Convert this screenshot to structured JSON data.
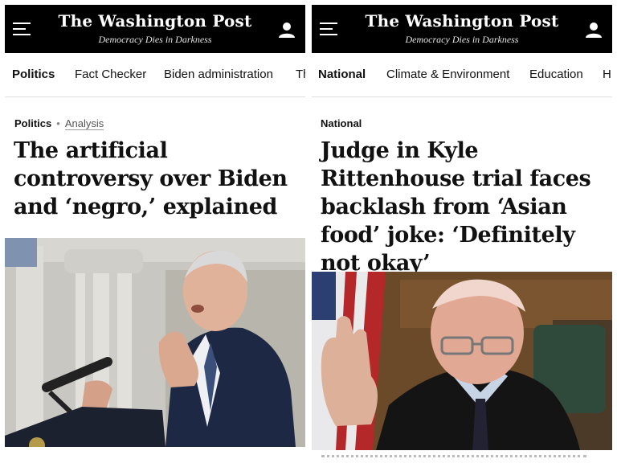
{
  "panels": [
    {
      "masthead": {
        "logo": "The Washington Post",
        "tagline": "Democracy Dies in Darkness"
      },
      "nav": [
        "Politics",
        "Fact Checker",
        "Biden administration",
        "Th"
      ],
      "active_nav": "Politics",
      "kicker": "Politics",
      "label": "Analysis",
      "headline": "The artificial controversy over Biden and ‘negro,’ explained",
      "image": "photo-biden-speaking-at-podium"
    },
    {
      "masthead": {
        "logo": "The Washington Post",
        "tagline": "Democracy Dies in Darkness"
      },
      "nav": [
        "National",
        "Climate & Environment",
        "Education",
        "H"
      ],
      "active_nav": "National",
      "kicker": "National",
      "headline": "Judge in Kyle Rittenhouse trial faces backlash from ‘Asian food’ joke: ‘Definitely not okay’",
      "image": "photo-judge-raising-hand"
    }
  ],
  "icons": {
    "menu": "hamburger-menu-icon",
    "profile": "user-account-icon"
  },
  "colors": {
    "masthead_bg": "#000000",
    "text": "#111111",
    "divider": "#e0e0e0"
  }
}
